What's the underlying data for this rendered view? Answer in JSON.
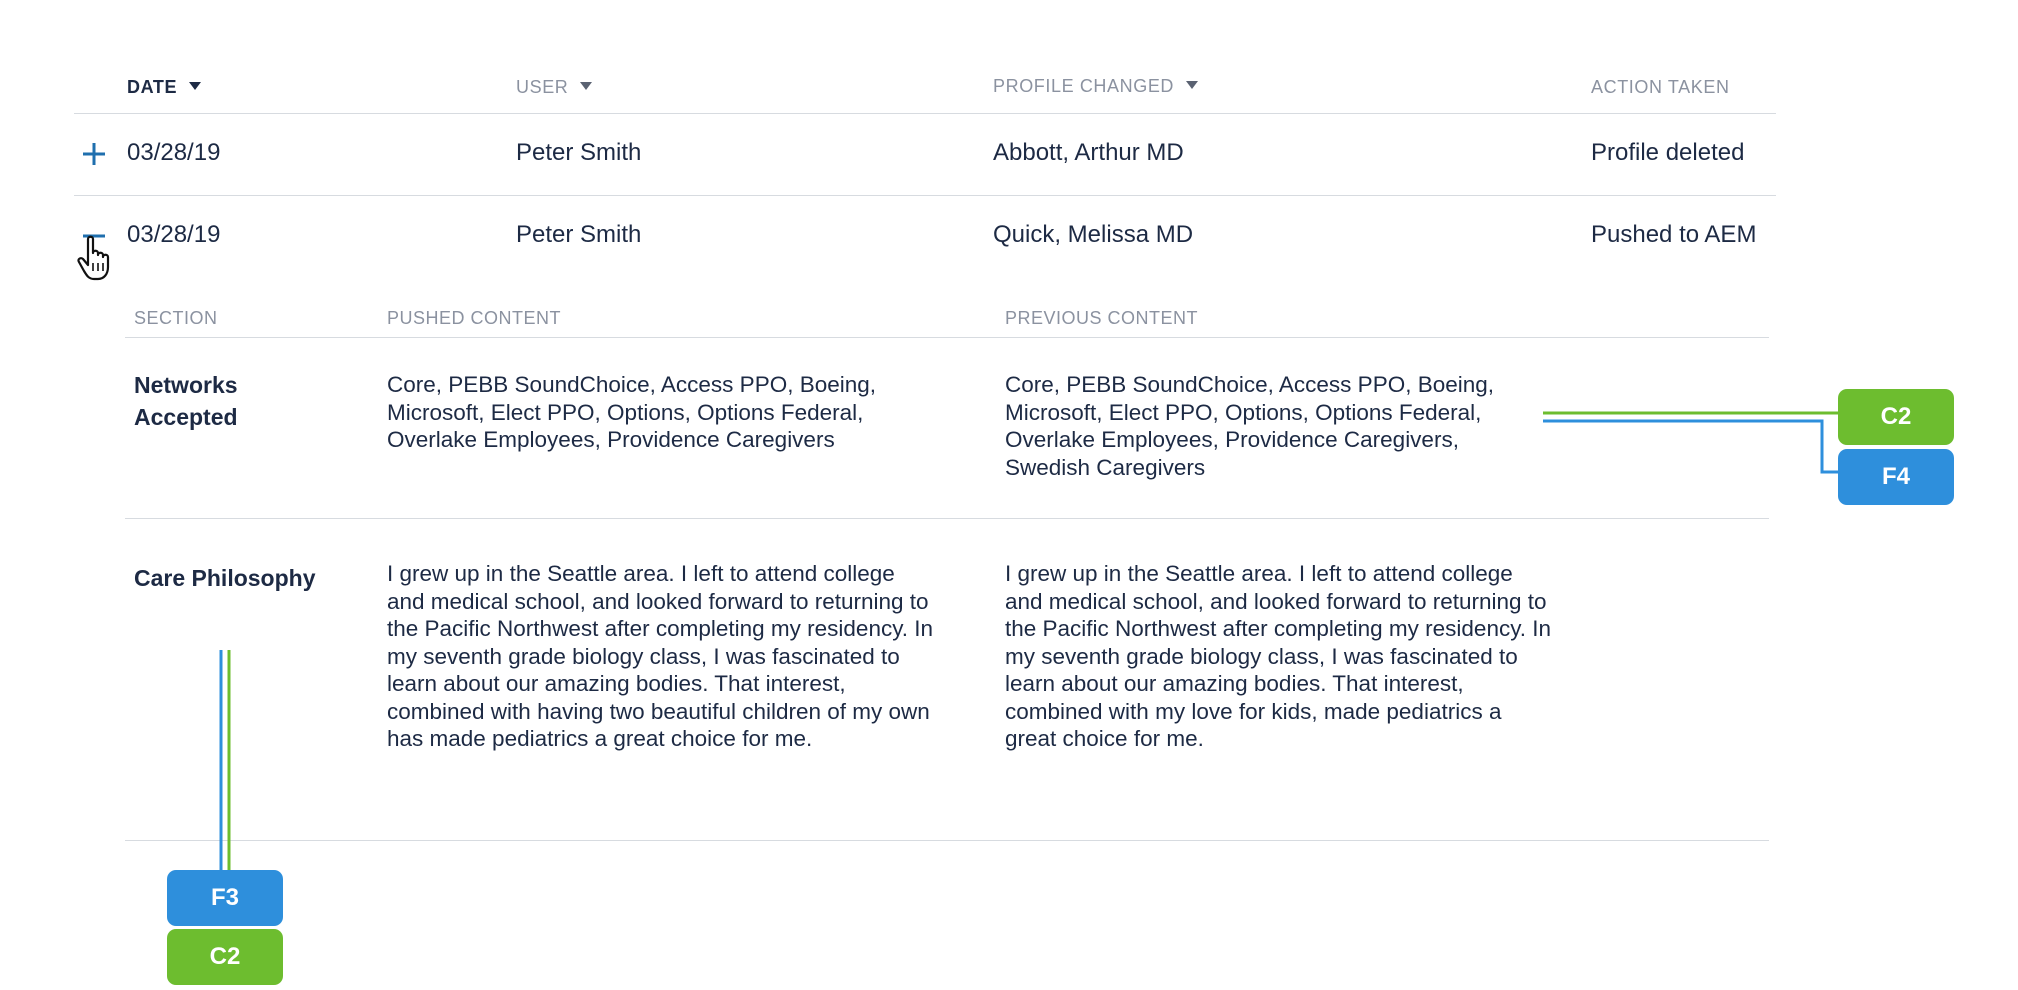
{
  "table": {
    "columns": [
      {
        "label": "DATE",
        "sortable": true,
        "active": true
      },
      {
        "label": "USER",
        "sortable": true
      },
      {
        "label": "PROFILE CHANGED",
        "sortable": true
      },
      {
        "label": "ACTION TAKEN",
        "sortable": false
      }
    ],
    "rows": [
      {
        "date": "03/28/19",
        "user": "Peter Smith",
        "profile": "Abbott, Arthur MD",
        "action": "Profile deleted",
        "toggle": "expand",
        "expanded": false
      },
      {
        "date": "03/28/19",
        "user": "Peter Smith",
        "profile": "Quick, Melissa MD",
        "action": "Pushed to AEM",
        "toggle": "collapse",
        "expanded": true
      }
    ]
  },
  "details": {
    "headers": {
      "section": "SECTION",
      "pushed": "PUSHED CONTENT",
      "previous": "PREVIOUS CONTENT"
    },
    "sections": [
      {
        "label": "Networks Accepted",
        "pushed": "Core, PEBB SoundChoice, Access PPO, Boeing, Microsoft, Elect PPO, Options, Options Federal, Overlake Employees, Providence Caregivers",
        "previous": "Core, PEBB SoundChoice, Access PPO, Boeing, Microsoft, Elect PPO, Options, Options Federal, Overlake Employees, Providence Caregivers, Swedish Caregivers"
      },
      {
        "label": "Care Philosophy",
        "pushed": "I grew up in the Seattle area. I left to attend college and medical school, and looked forward to returning to the Pacific Northwest after completing my residency. In my seventh grade biology class, I was fascinated to learn about our amazing bodies. That interest, combined with having two beautiful children of my own has made pediatrics a great choice for me.",
        "previous": "I grew up in the Seattle area. I left to attend college and medical school, and looked forward to returning to the Pacific Northwest after completing my residency. In my seventh grade biology class, I was fascinated to learn about our amazing bodies. That interest, combined with my love for kids, made pediatrics a great choice for me."
      }
    ]
  },
  "annotations": {
    "right": [
      {
        "label": "C2",
        "color": "#6dbd2f"
      },
      {
        "label": "F4",
        "color": "#2e8fdc"
      }
    ],
    "bottom": [
      {
        "label": "F3",
        "color": "#2e8fdc"
      },
      {
        "label": "C2",
        "color": "#6dbd2f"
      }
    ]
  },
  "colors": {
    "accent": "#1f6fae",
    "green": "#6dbd2f",
    "blue": "#2e8fdc",
    "divider": "#d7dbe0"
  },
  "icons": {
    "expand": "plus-icon",
    "collapse": "minus-icon",
    "cursor": "hand-pointer-icon"
  }
}
